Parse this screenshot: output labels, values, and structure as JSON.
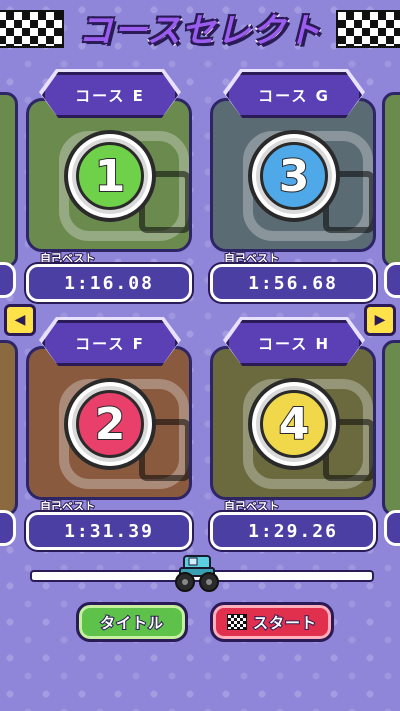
{
  "header": {
    "title": "コースセレクト",
    "icon": "checkered-flag-icon"
  },
  "courses": [
    {
      "name": "コース E",
      "number": "1",
      "best_label": "自己ベスト",
      "best_time": "1:16.08",
      "badge_color": "#6fd14a",
      "thumb_color": "#6b8a4e"
    },
    {
      "name": "コース G",
      "number": "3",
      "best_label": "自己ベスト",
      "best_time": "1:56.68",
      "badge_color": "#4fa8e8",
      "thumb_color": "#5a6b74"
    },
    {
      "name": "コース F",
      "number": "2",
      "best_label": "自己ベスト",
      "best_time": "1:31.39",
      "badge_color": "#e8406a",
      "thumb_color": "#8a5a3e"
    },
    {
      "name": "コース H",
      "number": "4",
      "best_label": "自己ベスト",
      "best_time": "1:29.26",
      "badge_color": "#f0d84a",
      "thumb_color": "#6a6a3e"
    }
  ],
  "navigation": {
    "prev_icon": "arrow-left-icon",
    "next_icon": "arrow-right-icon"
  },
  "scroll": {
    "position": 0.5,
    "thumb_icon": "monster-truck-icon"
  },
  "buttons": {
    "title_label": "タイトル",
    "start_label": "スタート"
  },
  "colors": {
    "background": "#8f86d9",
    "accent_purple": "#5a3fb5",
    "title_green": "#5ec24a",
    "start_red": "#e0304d"
  }
}
